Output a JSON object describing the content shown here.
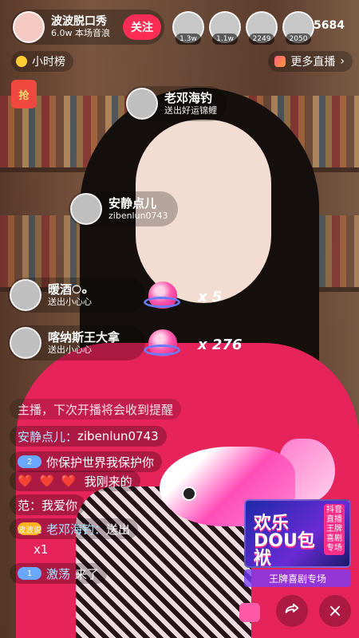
{
  "header": {
    "host_name": "波波脱口秀",
    "host_sub": "6.0w 本场音浪",
    "follow_label": "关注",
    "viewer_badges": [
      "1.3w",
      "1.1w",
      "2249",
      "2050"
    ],
    "online_count": "5684"
  },
  "row2": {
    "hour_rank_label": "小时榜",
    "more_live_label": "更多直播"
  },
  "envelope": {
    "label": "抢"
  },
  "notices": [
    {
      "name": "老邓海钓",
      "sub": "送出好运锦鲤"
    },
    {
      "name": "安静点儿",
      "sub": "zibenlun0743"
    },
    {
      "name": "暖酒ം",
      "sub": "送出小心心",
      "combo": "x 5"
    },
    {
      "name": "喀纳斯王大拿",
      "sub": "送出小心心",
      "combo": "x 276"
    }
  ],
  "comments": [
    {
      "badge": "",
      "user": "",
      "text": "主播，下次开播将会收到提醒"
    },
    {
      "badge": "",
      "user": "安静点儿：",
      "text": "zibenlun0743"
    },
    {
      "badge": "2",
      "user": "",
      "text": "你保护世界我保护你"
    },
    {
      "badge": "",
      "user": "",
      "hearts": "❤️ ❤️ ❤️",
      "text": "我刚来的"
    },
    {
      "badge": "",
      "user": "",
      "text": "范：我爱你"
    },
    {
      "badge": "波波说",
      "user": "老邓海钓：",
      "text": "送出"
    },
    {
      "badge": "",
      "user": "",
      "text": "x1"
    },
    {
      "badge": "1",
      "user": "激荡",
      "text": "来了"
    }
  ],
  "promo": {
    "title": "欢乐DOU包袱",
    "side_label": "王牌喜剧专场",
    "side_prefix": "抖音直播",
    "caption": "王牌喜剧专场"
  },
  "icons": {
    "share": "share-icon",
    "close": "close-icon"
  }
}
